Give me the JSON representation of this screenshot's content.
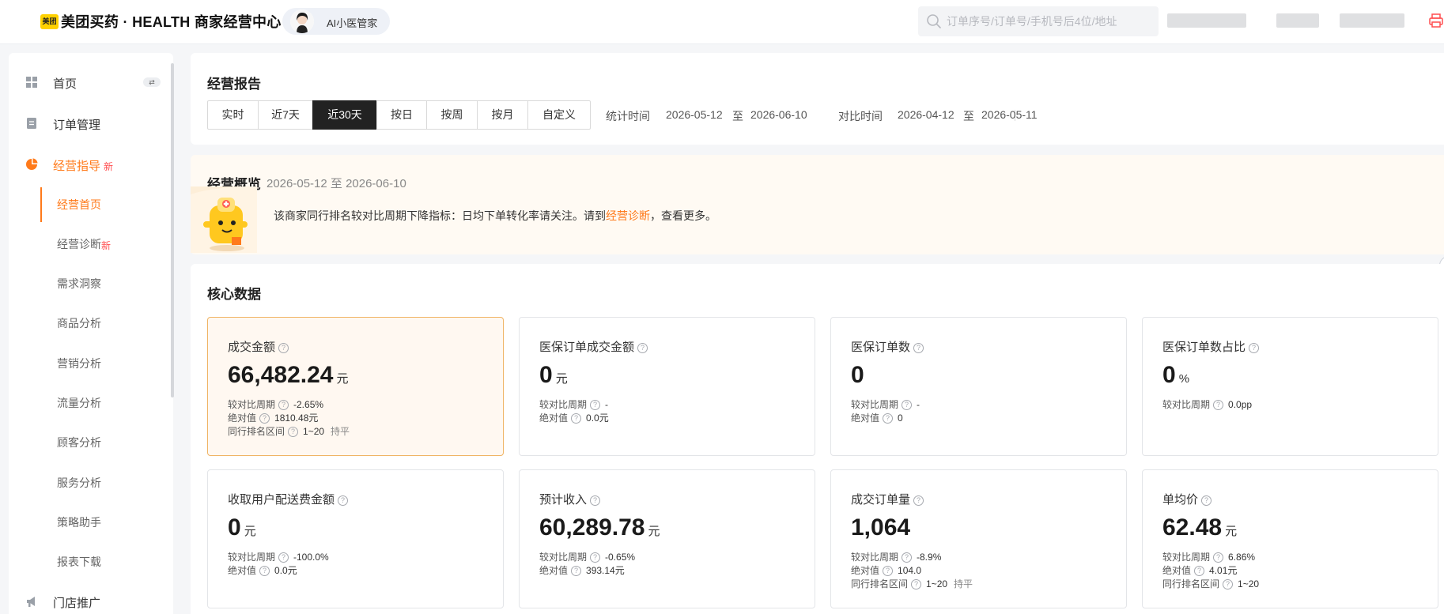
{
  "header": {
    "logo_text": "美团",
    "app_title": "美团买药 · HEALTH 商家经营中心",
    "ai_assistant_label": "AI小医管家",
    "search": {
      "placeholder": "订单序号/订单号/手机号后4位/地址",
      "value": ""
    },
    "icons": [
      "search-icon",
      "printer-icon"
    ],
    "accent_color": "#ff7a1a"
  },
  "sidebar": {
    "items": [
      {
        "label": "首页",
        "icon": "grid-icon"
      },
      {
        "label": "订单管理",
        "icon": "document-icon"
      },
      {
        "label": "经营指导",
        "icon": "pie-icon",
        "badge": "新"
      },
      {
        "label": "门店推广",
        "icon": "megaphone-icon"
      }
    ],
    "subitems": [
      {
        "label": "经营首页",
        "active": true
      },
      {
        "label": "经营诊断",
        "badge": "新"
      },
      {
        "label": "需求洞察"
      },
      {
        "label": "商品分析"
      },
      {
        "label": "营销分析"
      },
      {
        "label": "流量分析"
      },
      {
        "label": "顾客分析"
      },
      {
        "label": "服务分析"
      },
      {
        "label": "策略助手"
      },
      {
        "label": "报表下载"
      }
    ]
  },
  "report": {
    "title": "经营报告",
    "tabs": [
      "实时",
      "近7天",
      "近30天",
      "按日",
      "按周",
      "按月",
      "自定义"
    ],
    "active_tab": "近30天",
    "stat_label": "统计时间",
    "stat_start": "2026-05-12",
    "stat_to": "至",
    "stat_end": "2026-06-10",
    "compare_label": "对比时间",
    "compare_start": "2026-04-12",
    "compare_to": "至",
    "compare_end": "2026-05-11"
  },
  "overview": {
    "title": "经营概览",
    "date_range": "2026-05-12 至 2026-06-10",
    "message_before": "该商家同行排名较对比周期下降指标：日均下单转化率请关注。请到",
    "message_link": "经营诊断",
    "message_after": "，查看更多。"
  },
  "core": {
    "title": "核心数据",
    "cards": [
      {
        "title": "成交金额",
        "value": "66,482.24",
        "unit": "元",
        "highlight": true,
        "metrics": [
          {
            "label": "较对比周期",
            "value": "-2.65%"
          },
          {
            "label": "绝对值",
            "value": "1810.48元"
          },
          {
            "label": "同行排名区间",
            "value": "1~20",
            "extra": "持平"
          }
        ]
      },
      {
        "title": "医保订单成交金额",
        "value": "0",
        "unit": "元",
        "metrics": [
          {
            "label": "较对比周期",
            "value": "-"
          },
          {
            "label": "绝对值",
            "value": "0.0元"
          }
        ]
      },
      {
        "title": "医保订单数",
        "value": "0",
        "unit": "",
        "metrics": [
          {
            "label": "较对比周期",
            "value": "-"
          },
          {
            "label": "绝对值",
            "value": "0"
          }
        ]
      },
      {
        "title": "医保订单数占比",
        "value": "0",
        "unit": "%",
        "metrics": [
          {
            "label": "较对比周期",
            "value": "0.0pp"
          }
        ]
      },
      {
        "title": "收取用户配送费金额",
        "value": "0",
        "unit": "元",
        "metrics": [
          {
            "label": "较对比周期",
            "value": "-100.0%"
          },
          {
            "label": "绝对值",
            "value": "0.0元"
          }
        ]
      },
      {
        "title": "预计收入",
        "value": "60,289.78",
        "unit": "元",
        "metrics": [
          {
            "label": "较对比周期",
            "value": "-0.65%"
          },
          {
            "label": "绝对值",
            "value": "393.14元"
          }
        ]
      },
      {
        "title": "成交订单量",
        "value": "1,064",
        "unit": "",
        "metrics": [
          {
            "label": "较对比周期",
            "value": "-8.9%"
          },
          {
            "label": "绝对值",
            "value": "104.0"
          },
          {
            "label": "同行排名区间",
            "value": "1~20",
            "extra": "持平"
          }
        ]
      },
      {
        "title": "单均价",
        "value": "62.48",
        "unit": "元",
        "metrics": [
          {
            "label": "较对比周期",
            "value": "6.86%"
          },
          {
            "label": "绝对值",
            "value": "4.01元"
          },
          {
            "label": "同行排名区间",
            "value": "1~20"
          }
        ]
      }
    ]
  }
}
